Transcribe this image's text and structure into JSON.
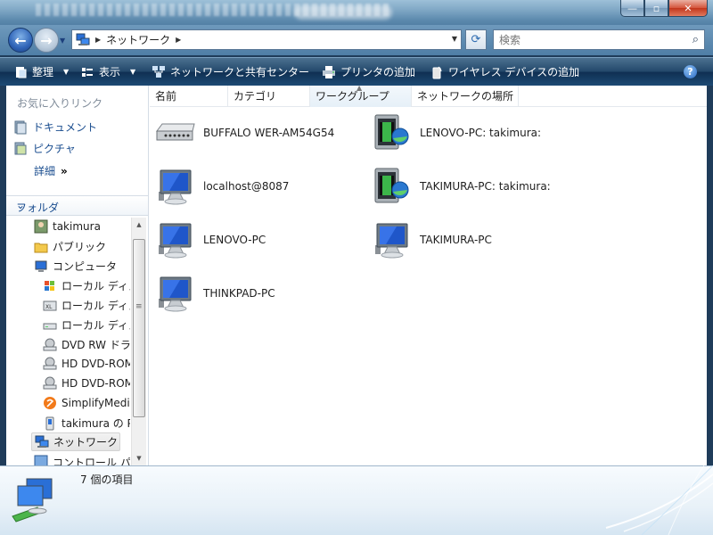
{
  "window": {
    "caption_min": "—",
    "caption_max": "▫",
    "caption_close": "✕"
  },
  "address": {
    "path": "ネットワーク",
    "search_placeholder": "検索"
  },
  "toolbar": {
    "organize": "整理",
    "views": "表示",
    "network_center": "ネットワークと共有センター",
    "add_printer": "プリンタの追加",
    "add_wireless": "ワイヤレス デバイスの追加",
    "help": "?"
  },
  "favorites": {
    "title": "お気に入りリンク",
    "items": [
      "ドキュメント",
      "ピクチャ"
    ],
    "more": "詳細",
    "more_chevron": "»"
  },
  "folders": {
    "title": "フォルダ",
    "items": [
      "takimura",
      "パブリック",
      "コンピュータ",
      "ローカル ディスク",
      "ローカル ディスク",
      "ローカル ディスク",
      "DVD RW ドライブ",
      "HD DVD-ROM",
      "HD DVD-ROM",
      "SimplifyMedia",
      "takimura の P",
      "ネットワーク",
      "コントロール パネル"
    ]
  },
  "columns": [
    "名前",
    "カテゴリ",
    "ワークグループ",
    "ネットワークの場所"
  ],
  "files": [
    {
      "name": "BUFFALO WER-AM54G54",
      "icon": "router-icon"
    },
    {
      "name": "LENOVO-PC: takimura:",
      "icon": "media-server-icon"
    },
    {
      "name": "localhost@8087",
      "icon": "computer-icon"
    },
    {
      "name": "TAKIMURA-PC: takimura:",
      "icon": "media-server-icon"
    },
    {
      "name": "LENOVO-PC",
      "icon": "computer-icon"
    },
    {
      "name": "TAKIMURA-PC",
      "icon": "computer-icon"
    },
    {
      "name": "THINKPAD-PC",
      "icon": "computer-icon"
    }
  ],
  "status": {
    "item_count": "7 個の項目"
  },
  "colors": {
    "link": "#1a4d8f",
    "command_bar": "#1d4a74"
  }
}
